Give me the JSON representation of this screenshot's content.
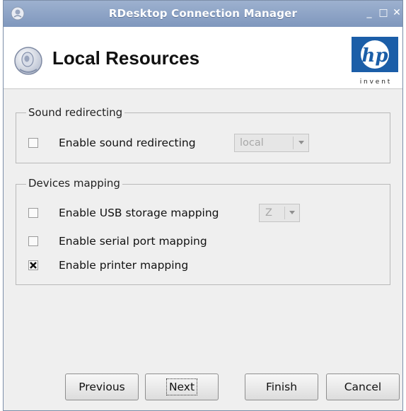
{
  "window": {
    "title": "RDesktop Connection Manager",
    "controls": {
      "minimize": "_",
      "maximize": "□",
      "close": "✕"
    }
  },
  "header": {
    "title": "Local Resources",
    "logo_text": "hp",
    "logo_tagline": "i n v e n t",
    "icon": "speaker-icon"
  },
  "sound": {
    "group_title": "Sound redirecting",
    "enable": {
      "label": "Enable sound redirecting",
      "checked": false
    },
    "mode": {
      "value": "local",
      "enabled": false
    }
  },
  "devices": {
    "group_title": "Devices mapping",
    "usb": {
      "label": "Enable USB storage mapping",
      "checked": false
    },
    "usb_drive": {
      "value": "Z",
      "enabled": false
    },
    "serial": {
      "label": "Enable serial port mapping",
      "checked": false
    },
    "printer": {
      "label": "Enable printer mapping",
      "checked": true
    }
  },
  "buttons": {
    "previous": "Previous",
    "next": "Next",
    "finish": "Finish",
    "cancel": "Cancel"
  },
  "colors": {
    "titlebar": "#8aa1c6",
    "hp_blue": "#1b5ea8",
    "panel": "#efefef"
  }
}
